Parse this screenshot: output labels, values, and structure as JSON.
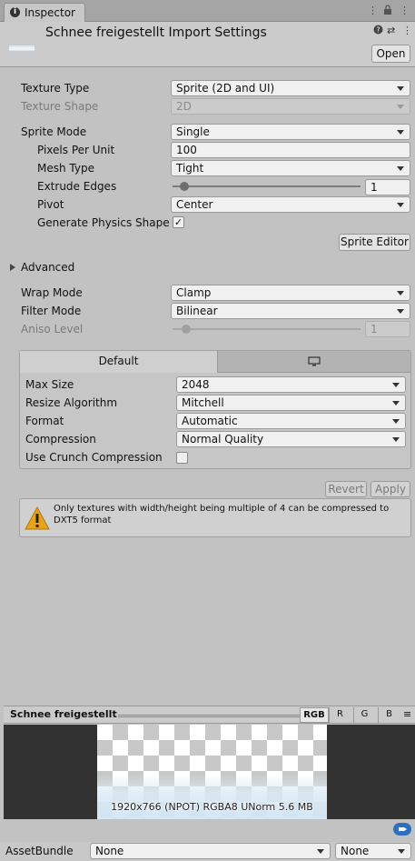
{
  "tab": {
    "label": "Inspector"
  },
  "header": {
    "title": "Schnee freigestellt Import Settings",
    "open_label": "Open"
  },
  "fields": {
    "texture_type": {
      "label": "Texture Type",
      "value": "Sprite (2D and UI)"
    },
    "texture_shape": {
      "label": "Texture Shape",
      "value": "2D"
    },
    "sprite_mode": {
      "label": "Sprite Mode",
      "value": "Single"
    },
    "pixels_per_unit": {
      "label": "Pixels Per Unit",
      "value": "100"
    },
    "mesh_type": {
      "label": "Mesh Type",
      "value": "Tight"
    },
    "extrude_edges": {
      "label": "Extrude Edges",
      "value": "1"
    },
    "pivot": {
      "label": "Pivot",
      "value": "Center"
    },
    "generate_physics_shape": {
      "label": "Generate Physics Shape",
      "checked": "✓"
    },
    "sprite_editor_label": "Sprite Editor",
    "advanced": "Advanced",
    "wrap_mode": {
      "label": "Wrap Mode",
      "value": "Clamp"
    },
    "filter_mode": {
      "label": "Filter Mode",
      "value": "Bilinear"
    },
    "aniso_level": {
      "label": "Aniso Level",
      "value": "1"
    }
  },
  "platform": {
    "tabs": {
      "default": "Default"
    },
    "max_size": {
      "label": "Max Size",
      "value": "2048"
    },
    "resize_algorithm": {
      "label": "Resize Algorithm",
      "value": "Mitchell"
    },
    "format": {
      "label": "Format",
      "value": "Automatic"
    },
    "compression": {
      "label": "Compression",
      "value": "Normal Quality"
    },
    "crunch": {
      "label": "Use Crunch Compression"
    }
  },
  "actions": {
    "revert": "Revert",
    "apply": "Apply"
  },
  "warning": {
    "text": "Only textures with width/height being multiple of 4 can be compressed to DXT5 format"
  },
  "preview": {
    "title": "Schnee freigestellt",
    "channels": [
      "RGB",
      "R",
      "G",
      "B"
    ],
    "info": "1920x766 (NPOT)  RGBA8 UNorm   5.6 MB"
  },
  "asset_bundle": {
    "label": "AssetBundle",
    "value": "None",
    "variant": "None"
  }
}
